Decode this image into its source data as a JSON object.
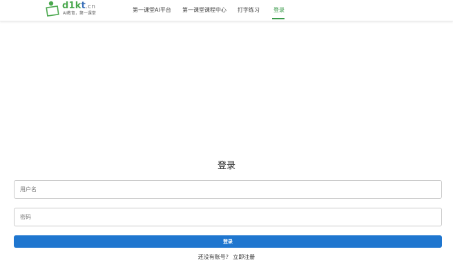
{
  "header": {
    "logo": {
      "brand_d1k": "d1k",
      "brand_t": "t",
      "brand_cn": ".cn",
      "slogan": "AI教育，第一课堂"
    },
    "nav": [
      {
        "label": "第一课堂AI平台"
      },
      {
        "label": "第一课堂课程中心"
      },
      {
        "label": "打字练习"
      },
      {
        "label": "登录",
        "active": true
      }
    ]
  },
  "login": {
    "title": "登录",
    "username_placeholder": "用户名",
    "password_placeholder": "密码",
    "submit_label": "登录",
    "no_account_text": "还没有账号？",
    "register_link": "立即注册"
  },
  "colors": {
    "accent_green": "#3a9a4a",
    "button_blue": "#1f76cf",
    "logo_blue": "#3a6fb8"
  }
}
